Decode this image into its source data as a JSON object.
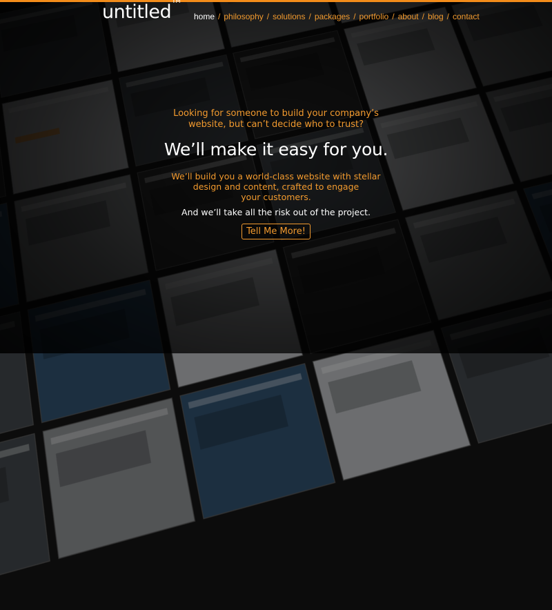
{
  "brand": {
    "name": "untitled",
    "mark": "TM"
  },
  "nav": {
    "items": [
      "home",
      "philosophy",
      "solutions",
      "packages",
      "portfolio",
      "about",
      "blog",
      "contact"
    ],
    "separator": "/",
    "active": "home"
  },
  "hero": {
    "question_line1": "Looking for someone to build your company’s",
    "question_line2": "website, but can’t decide who to trust?",
    "headline": "We’ll make it easy for you.",
    "sub_line1": "We’ll build you a world-class website with stellar",
    "sub_line2": "design and content, crafted to engage",
    "sub_line3": "your customers.",
    "risk": "And we’ll take all the risk out of the project.",
    "cta_label": "Tell Me More!"
  },
  "colors": {
    "accent": "#f29a2e",
    "background": "#0c0c0c",
    "text": "#ffffff"
  }
}
